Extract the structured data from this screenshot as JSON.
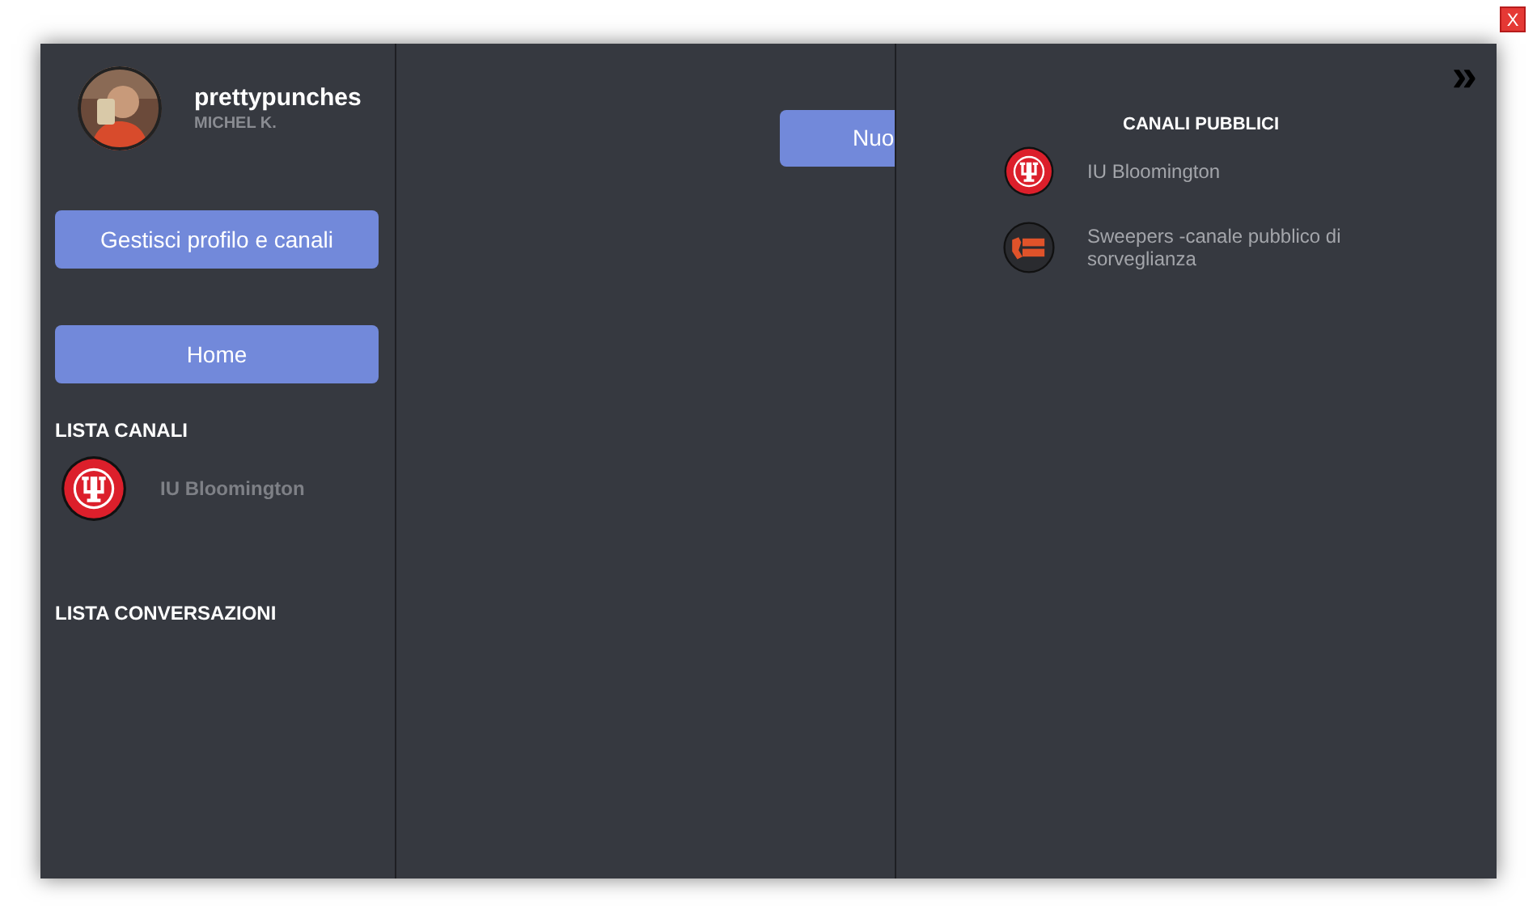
{
  "close_button": "X",
  "profile": {
    "username": "prettypunches",
    "name": "MICHEL K."
  },
  "buttons": [
    "Gestisci profilo e canali",
    "Home"
  ],
  "channel_list": {
    "title": "LISTA CANALI",
    "items": [
      {
        "name": "IU Bloomington",
        "kind": "iu"
      }
    ]
  },
  "conversation_list": {
    "title": "LISTA CONVERSAZIONI"
  },
  "middle": {
    "button": "Nuo"
  },
  "public_channels": {
    "collapse": "»",
    "title": "CANALI PUBBLICI",
    "items": [
      {
        "name": "IU Bloomington",
        "kind": "iu"
      },
      {
        "name": "Sweepers -canale pubblico di sorveglianza",
        "kind": "sweepers"
      }
    ]
  }
}
